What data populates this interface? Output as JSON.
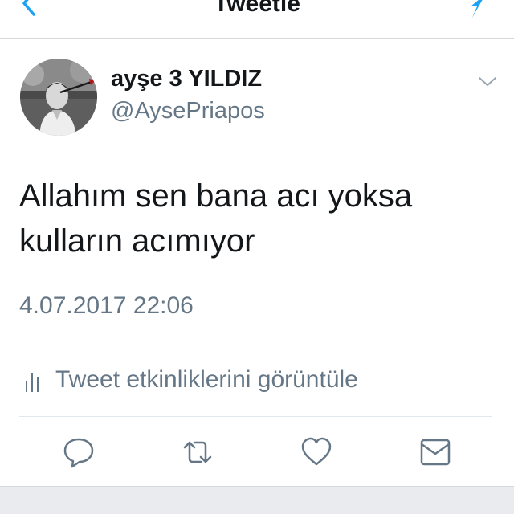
{
  "navbar": {
    "title": "Tweetle",
    "back_icon": "chevron-left-icon",
    "compose_icon": "compose-icon",
    "accent_color": "#1da1f2"
  },
  "tweet": {
    "author": {
      "display_name": "ayşe 3 YILDIZ",
      "handle": "@AysePriapos",
      "avatar_icon": "avatar-photo"
    },
    "text": "Allahım sen bana acı yoksa kulların acımıyor",
    "timestamp": "4.07.2017 22:06",
    "activity_label": "Tweet etkinliklerini görüntüle",
    "activity_icon": "bar-chart-icon",
    "menu_icon": "chevron-down-icon"
  },
  "actions": [
    {
      "icon": "reply-icon"
    },
    {
      "icon": "retweet-icon"
    },
    {
      "icon": "heart-icon"
    },
    {
      "icon": "envelope-icon"
    }
  ],
  "colors": {
    "text_primary": "#14171a",
    "text_secondary": "#657786",
    "divider": "#e1e8ed",
    "icon_gray": "#657786"
  }
}
